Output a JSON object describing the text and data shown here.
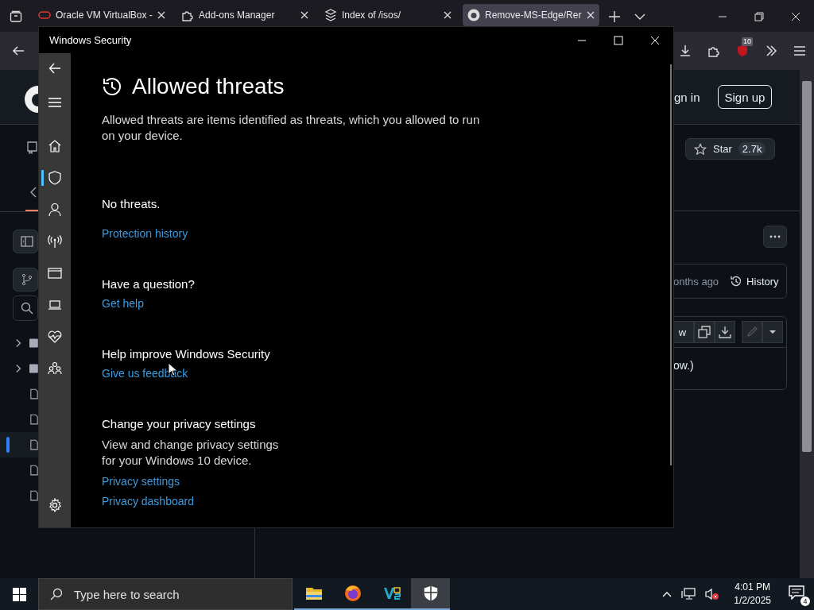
{
  "browser": {
    "tabs": [
      {
        "kind": "vbox",
        "title": "Oracle VM VirtualBox -",
        "selected": false
      },
      {
        "kind": "puzzle",
        "title": "Add-ons Manager",
        "selected": false
      },
      {
        "kind": "stack",
        "title": "Index of /isos/",
        "selected": false
      },
      {
        "kind": "github",
        "title": "Remove-MS-Edge/Rer",
        "selected": true
      }
    ],
    "extension_badge": "10"
  },
  "page": {
    "sign_in": "gn in",
    "sign_up": "Sign up",
    "star_label": "Star",
    "star_count": "2.7k",
    "commit_time": "onths ago",
    "history": "History",
    "raw_button": "w",
    "file_text": "ow.)",
    "tree_rows": [
      {
        "kind": "folder",
        "selected": false
      },
      {
        "kind": "folder",
        "selected": false
      },
      {
        "kind": "file",
        "selected": false
      },
      {
        "kind": "file",
        "selected": false
      },
      {
        "kind": "file",
        "selected": true
      },
      {
        "kind": "file",
        "selected": false
      },
      {
        "kind": "file",
        "selected": false
      }
    ]
  },
  "security_window": {
    "title": "Windows Security",
    "nav": [
      {
        "kind": "home",
        "selected": false
      },
      {
        "kind": "shield",
        "selected": true
      },
      {
        "kind": "person",
        "selected": false
      },
      {
        "kind": "antenna",
        "selected": false
      },
      {
        "kind": "browser",
        "selected": false
      },
      {
        "kind": "laptop",
        "selected": false
      },
      {
        "kind": "heart",
        "selected": false
      },
      {
        "kind": "family",
        "selected": false
      },
      {
        "kind": "settings",
        "selected": false
      }
    ],
    "heading": "Allowed threats",
    "description": "Allowed threats are items identified as threats, which you allowed to run on your device.",
    "status": "No threats.",
    "history_link": "Protection history",
    "sections": [
      {
        "title": "Have a question?",
        "links": [
          "Get help"
        ]
      },
      {
        "title": "Help improve Windows Security",
        "links": [
          "Give us feedback"
        ]
      },
      {
        "title": "Change your privacy settings",
        "text": "View and change privacy settings for your Windows 10 device.",
        "links": [
          "Privacy settings",
          "Privacy dashboard"
        ]
      }
    ]
  },
  "taskbar": {
    "search_placeholder": "Type here to search",
    "apps": [
      {
        "kind": "explorer",
        "selected": false
      },
      {
        "kind": "firefox",
        "selected": false
      },
      {
        "kind": "vs",
        "selected": false
      },
      {
        "kind": "defender",
        "selected": true
      }
    ],
    "time": "4:01 PM",
    "date": "1/2/2025",
    "notification_count": "4"
  }
}
